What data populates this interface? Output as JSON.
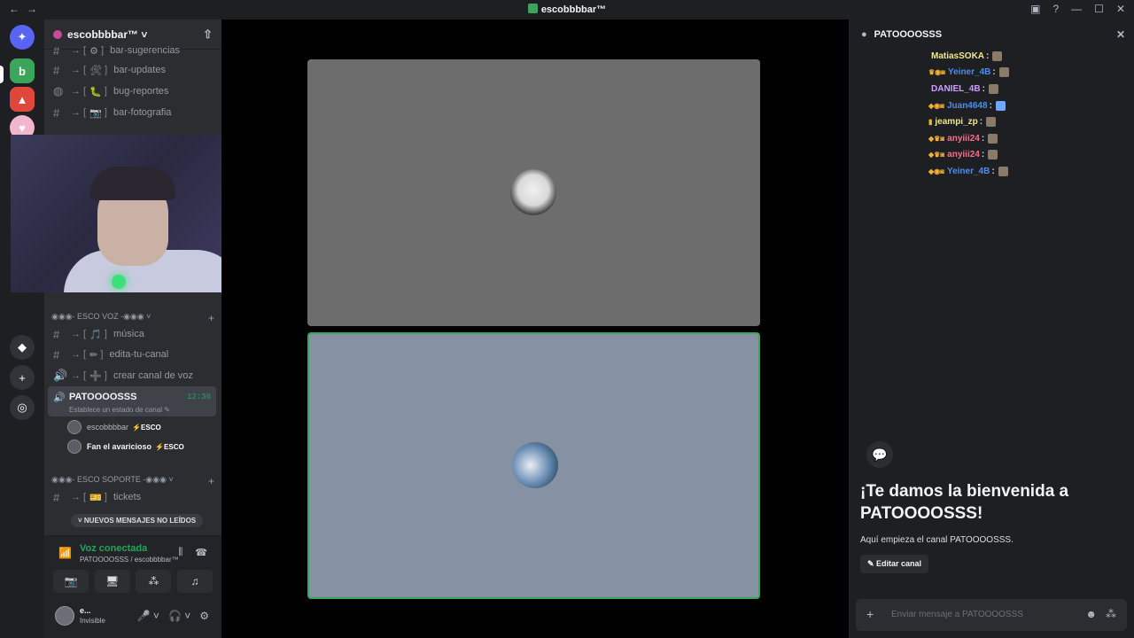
{
  "titlebar": {
    "title": "escobbbbar™",
    "nav": "←→",
    "icons": [
      "inbox-icon",
      "help-icon",
      "minimize-icon",
      "maximize-icon",
      "close-icon"
    ],
    "minimize": "—",
    "maximize": "☐",
    "close": "✕",
    "help": "?",
    "inbox": "▣"
  },
  "servers": [
    {
      "name": "discord-home",
      "glyph": "✦",
      "color": "#5865f2"
    },
    {
      "name": "server-green",
      "glyph": "b",
      "color": "#3ba55c"
    },
    {
      "name": "server-game",
      "glyph": "▲",
      "color": "#e0473b"
    },
    {
      "name": "server-pink",
      "glyph": "♥",
      "color": "#f2b6cc"
    },
    {
      "name": "server-explore",
      "glyph": "◆",
      "color": "#313338"
    },
    {
      "name": "add-server",
      "glyph": "+",
      "color": "#313338"
    },
    {
      "name": "discover",
      "glyph": "◎",
      "color": "#313338"
    }
  ],
  "guild": {
    "name": "escobbbbar™ ˅",
    "add_user": "⇧"
  },
  "channels_top": [
    {
      "label": "bar-sugerencias",
      "emoji": "⚙"
    },
    {
      "label": "bar-updates",
      "emoji": "🛠"
    },
    {
      "label": "bug-reportes",
      "emoji": "🐛"
    },
    {
      "label": "bar-fotografia",
      "emoji": "📷"
    }
  ],
  "category_voice": {
    "label": "◉◉◉- ESCO VOZ -◉◉◉ ˅",
    "plus": "+"
  },
  "channels_voice": [
    {
      "label": "música",
      "emoji": "🎵",
      "type": "#"
    },
    {
      "label": "edita-tu-canal",
      "emoji": "✏",
      "type": "#"
    },
    {
      "label": "crear canal de voz",
      "emoji": "➕",
      "type": "🔊"
    }
  ],
  "active_voice": {
    "name": "PATOOOOSSS",
    "time": "12:36",
    "status": "Establece un estado de canal ✎",
    "icon": "🔊"
  },
  "voice_users": [
    {
      "name": "escobbbbar",
      "tag": "ESCO"
    },
    {
      "name": "Fan el avaricioso",
      "tag": "ESCO"
    }
  ],
  "category_support": {
    "label": "◉◉◉- ESCO SOPORTE -◉◉◉ ˅",
    "plus": "+"
  },
  "channels_support": [
    {
      "label": "tickets",
      "emoji": "🎫"
    }
  ],
  "unread_pill": "˅  NUEVOS MENSAJES NO LEÍDOS",
  "voice_panel": {
    "title": "Voz conectada",
    "subtitle": "PATOOOOSSS / escobbbbar™",
    "icons": {
      "signal": "📶",
      "noise": "⫼",
      "disconnect": "☎"
    },
    "buttons": {
      "camera": "📷",
      "screen": "🖥",
      "activities": "⁂",
      "soundboard": "♫"
    }
  },
  "user_panel": {
    "name": "e...",
    "status": "Invisible",
    "mic": "🎤 ˅",
    "headset": "🎧 ˅",
    "settings": "⚙"
  },
  "chat": {
    "title": "PATOOOOSSS",
    "close": "✕",
    "messages": [
      {
        "badges": "",
        "user": "MatiasSOKA",
        "color": "#f0e68c"
      },
      {
        "badges": "♛◉◙",
        "user": "Yeiner_4B",
        "color": "#4b8df0"
      },
      {
        "badges": "",
        "user": "DANIEL_4B",
        "color": "#c9a0ff"
      },
      {
        "badges": "◆◉◙",
        "user": "Juan4648",
        "color": "#4b8df0"
      },
      {
        "badges": "▮",
        "user": "jeampi_zp",
        "color": "#f0e68c"
      },
      {
        "badges": "◆♛◙",
        "user": "anyiii24",
        "color": "#ff6b8a"
      },
      {
        "badges": "◆♛◙",
        "user": "anyiii24",
        "color": "#ff6b8a"
      },
      {
        "badges": "◆◉◙",
        "user": "Yeiner_4B",
        "color": "#4b8df0"
      }
    ],
    "welcome_icon": "💬",
    "welcome_title": "¡Te damos la bienvenida a PATOOOOSSS!",
    "welcome_sub": "Aquí empieza el canal PATOOOOSSS.",
    "edit_button": "✎ Editar canal",
    "placeholder": "Enviar mensaje a PATOOOOSSS",
    "plus": "+",
    "emoji": "☻",
    "apps": "⁂"
  }
}
